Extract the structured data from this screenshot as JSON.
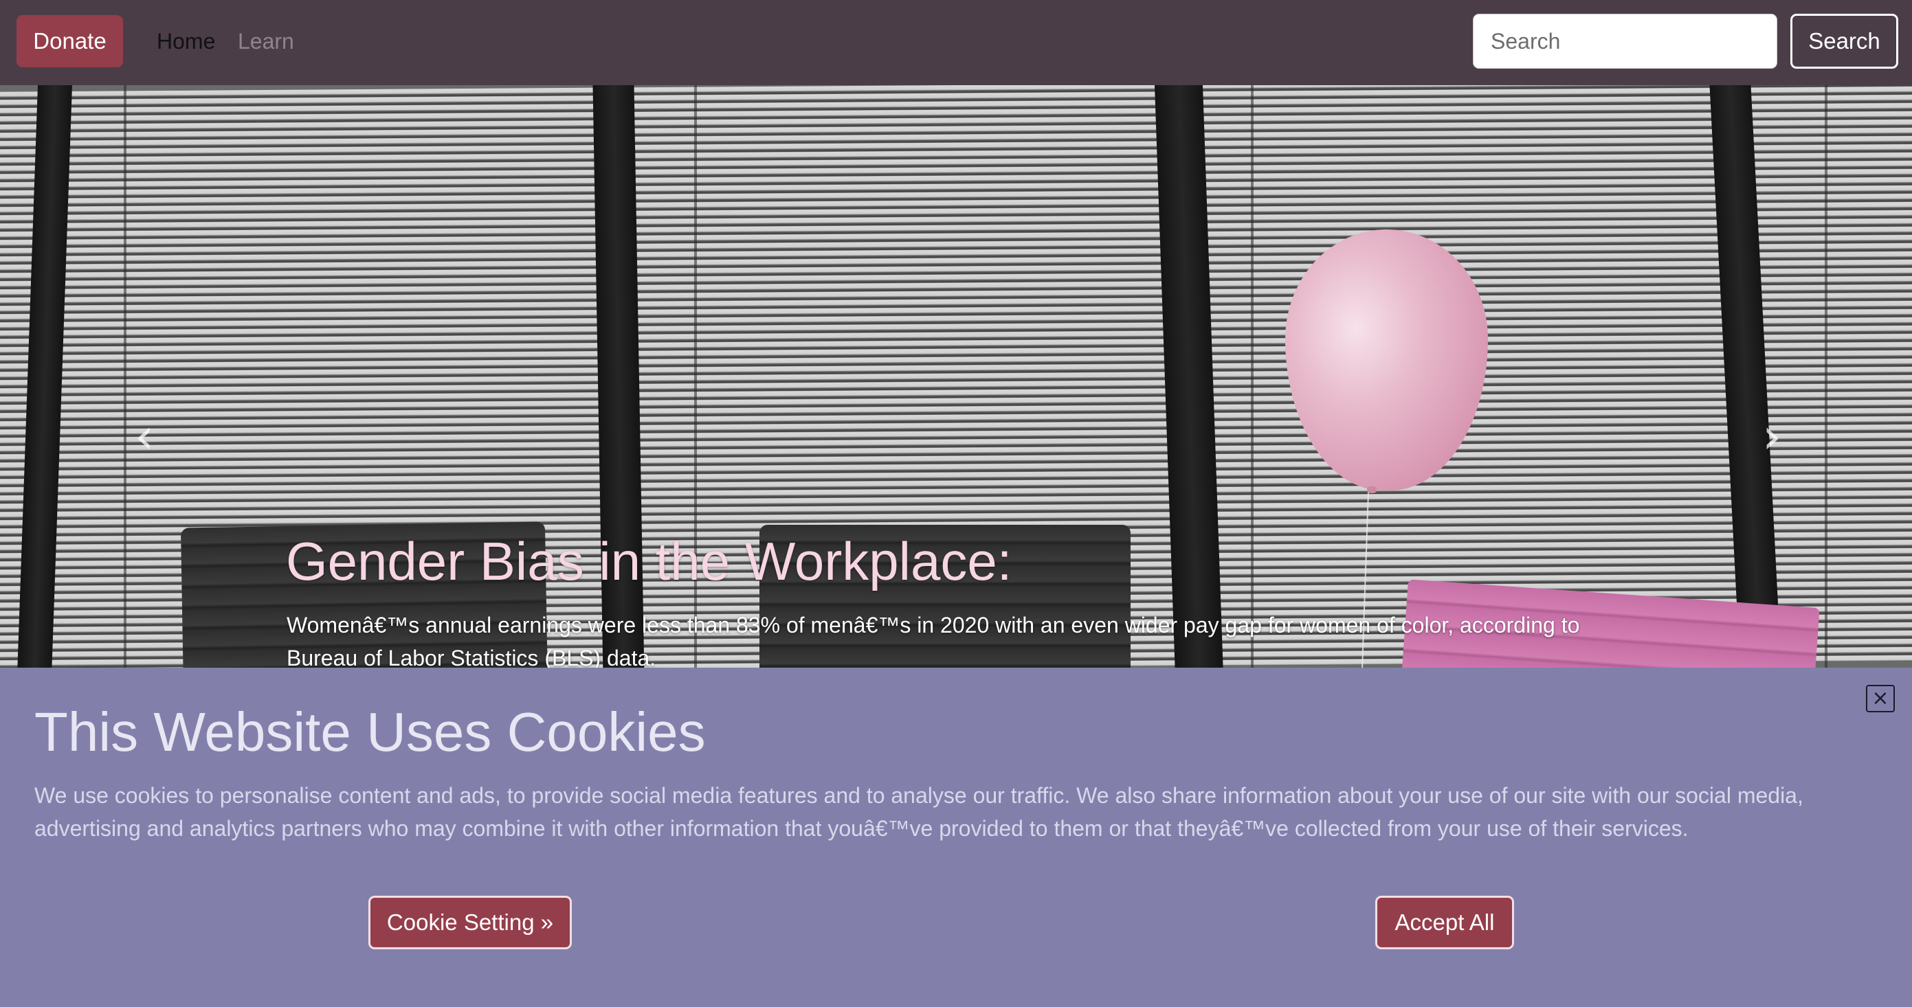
{
  "navbar": {
    "donate_label": "Donate",
    "links": [
      {
        "label": "Home",
        "active": true
      },
      {
        "label": "Learn",
        "active": false
      }
    ],
    "search_placeholder": "Search",
    "search_button_label": "Search"
  },
  "hero": {
    "title": "Gender Bias in the Workplace:",
    "text": "Womenâ€™s annual earnings were less than 83% of menâ€™s in 2020 with an even wider pay gap for women of color, according to Bureau of Labor Statistics (BLS) data.",
    "prev_icon": "chevron-left-icon",
    "next_icon": "chevron-right-icon",
    "prev_glyph": "‹",
    "next_glyph": "›"
  },
  "cookie_banner": {
    "title": "This Website Uses Cookies",
    "text": "We use cookies to personalise content and ads, to provide social media features and to analyse our traffic. We also share information about your use of our site with our social media, advertising and analytics partners who may combine it with other information that youâ€™ve provided to them or that theyâ€™ve collected from your use of their services.",
    "close_glyph": "×",
    "setting_button_label": "Cookie Setting »",
    "accept_button_label": "Accept All"
  },
  "colors": {
    "navbar_bg": "#4b3d47",
    "button_primary": "#953e4b",
    "cookie_bg": "#8280ab",
    "hero_title": "#f7d5e3"
  }
}
